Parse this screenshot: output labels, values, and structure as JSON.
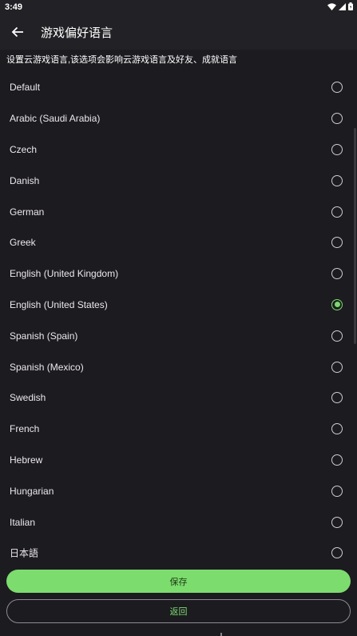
{
  "status_bar": {
    "time": "3:49"
  },
  "header": {
    "title": "游戏偏好语言"
  },
  "description": "设置云游戏语言,该选项会影响云游戏语言及好友、成就语言",
  "languages": [
    {
      "label": "Default",
      "selected": false
    },
    {
      "label": "Arabic (Saudi Arabia)",
      "selected": false
    },
    {
      "label": "Czech",
      "selected": false
    },
    {
      "label": "Danish",
      "selected": false
    },
    {
      "label": "German",
      "selected": false
    },
    {
      "label": "Greek",
      "selected": false
    },
    {
      "label": "English (United Kingdom)",
      "selected": false
    },
    {
      "label": "English (United States)",
      "selected": true
    },
    {
      "label": "Spanish (Spain)",
      "selected": false
    },
    {
      "label": "Spanish (Mexico)",
      "selected": false
    },
    {
      "label": "Swedish",
      "selected": false
    },
    {
      "label": "French",
      "selected": false
    },
    {
      "label": "Hebrew",
      "selected": false
    },
    {
      "label": "Hungarian",
      "selected": false
    },
    {
      "label": "Italian",
      "selected": false
    },
    {
      "label": "日本語",
      "selected": false
    }
  ],
  "buttons": {
    "save": "保存",
    "back": "返回"
  },
  "colors": {
    "accent": "#7ddc6e",
    "background": "#1c1b20"
  }
}
